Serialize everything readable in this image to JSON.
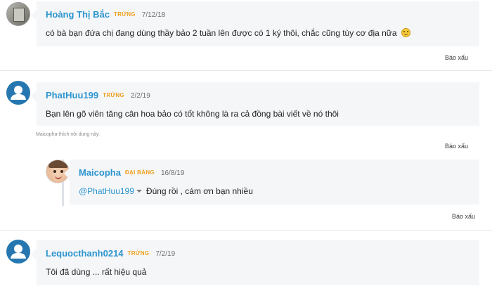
{
  "comments": [
    {
      "username": "Hoàng Thị Bắc",
      "rank": "TRỨNG",
      "date": "7/12/18",
      "text": "có bà bạn đứa chị đang dùng thầy bảo 2 tuần lên được có 1 ký thôi, chắc cũng tùy cơ địa nữa",
      "emoji": "smiley-icon",
      "report": "Báo xấu"
    },
    {
      "username": "PhatHuu199",
      "rank": "TRỨNG",
      "date": "2/2/19",
      "text": "Bạn lên gõ viên tăng cân hoa bảo có tốt không là ra cả đồng bài viết về nó thôi",
      "likes": "Maicopha thích nội dung này.",
      "report": "Báo xấu",
      "reply": {
        "username": "Maicopha",
        "rank": "ĐẠI BÀNG",
        "date": "16/8/19",
        "mention": "@PhatHuu199",
        "text": "Đúng rồi , cám ơn bạn nhiều",
        "report": "Báo xấu"
      }
    },
    {
      "username": "Lequocthanh0214",
      "rank": "TRỨNG",
      "date": "7/2/19",
      "text": "Tôi đã dùng ... rất hiệu quả"
    }
  ],
  "colors": {
    "username": "#2d95ce",
    "rank": "#f0a020",
    "bubble": "#f4f6f8",
    "avatar_default": "#2677b0"
  }
}
